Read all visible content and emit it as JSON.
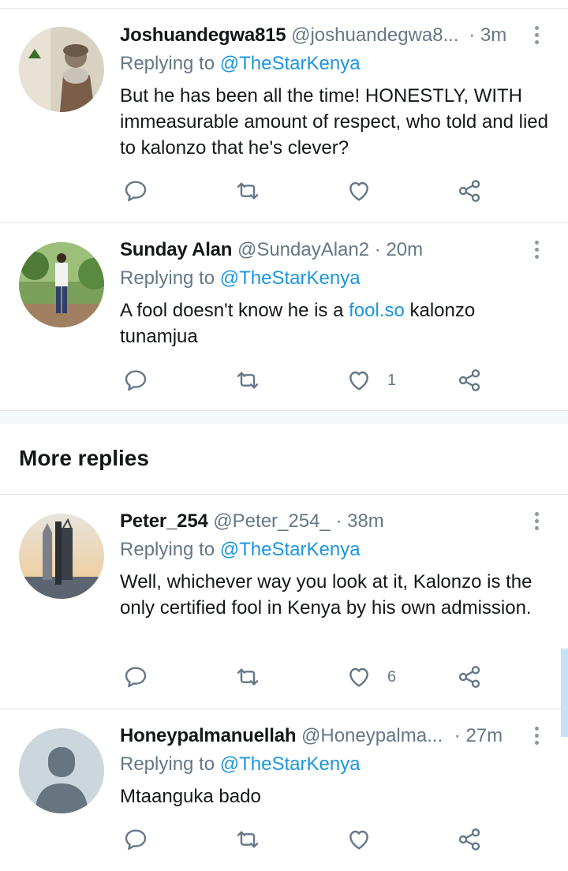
{
  "tweets": [
    {
      "name": "Joshuandegwa815",
      "handle": "@joshuandegwa8...",
      "time": "· 3m",
      "replying_label": "Replying to",
      "replying_to": "@TheStarKenya",
      "text_parts": [
        "But he has been all the time! HONESTLY, WITH immeasurable amount of respect, who told and lied to kalonzo that he's clever?"
      ],
      "like_count": ""
    },
    {
      "name": "Sunday Alan",
      "handle": "@SundayAlan2",
      "time": "· 20m",
      "replying_label": "Replying to",
      "replying_to": "@TheStarKenya",
      "text_before": "A fool doesn't know he is a ",
      "text_link": "fool.so",
      "text_after": " kalonzo tunamjua",
      "like_count": "1"
    },
    {
      "name": "Peter_254",
      "handle": "@Peter_254_",
      "time": "· 38m",
      "replying_label": "Replying to",
      "replying_to": "@TheStarKenya",
      "text": "Well, whichever way you look at it, Kalonzo is the only certified fool in Kenya by his own admission.",
      "like_count": "6"
    },
    {
      "name": "Honeypalmanuellah",
      "handle": "@Honeypalma...",
      "time": "· 27m",
      "replying_label": "Replying to",
      "replying_to": "@TheStarKenya",
      "text": "Mtaanguka bado",
      "like_count": ""
    }
  ],
  "section": {
    "more_replies": "More replies"
  },
  "icons": [
    "reply-icon",
    "retweet-icon",
    "like-icon",
    "share-icon",
    "more-options-icon"
  ],
  "colors": {
    "link": "#1b95e0",
    "secondary": "#657786",
    "icon": "#657786",
    "text": "#14171a"
  }
}
